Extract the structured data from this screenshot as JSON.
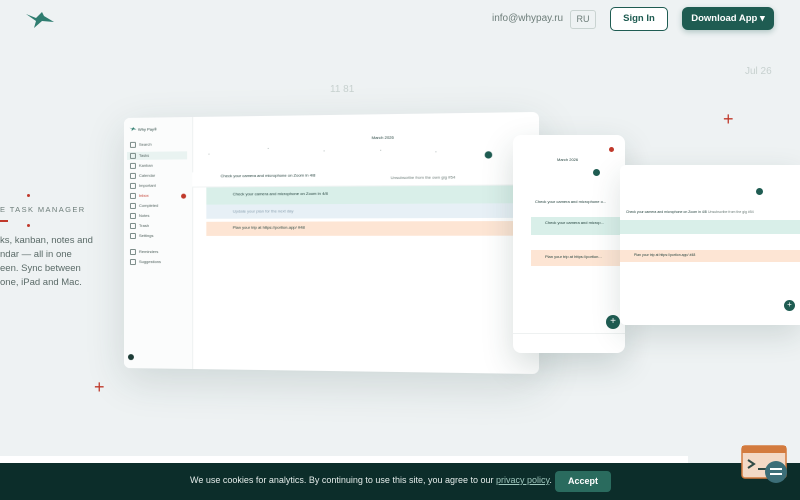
{
  "header": {
    "email": "info@whypay.ru",
    "lang": "RU",
    "sign_in": "Sign In",
    "download": "Download App ▾"
  },
  "decor": {
    "date_top_right": "Jul 26",
    "date_left": "11 81"
  },
  "hero": {
    "label": "E TASK MANAGER",
    "lines": [
      "ks, kanban, notes and",
      "ndar — all in one",
      "een. Sync between",
      "one, iPad and Mac."
    ]
  },
  "desktop_mock": {
    "app_name": "Why Pay®",
    "sidebar": [
      "Search",
      "Tasks",
      "Kanban",
      "Calendar",
      "Important",
      "Inbox",
      "Completed",
      "Notes",
      "Trash",
      "Settings",
      "Reminders",
      "Suggestions"
    ],
    "month": "March 2026",
    "tasks": [
      "Check your camera and microphone on Zoom in 4/8",
      "Check your camera and microphone on Zoom in 4/8",
      "Update your plan for the next day",
      "Plan your trip at https://portion.app/ #48"
    ],
    "task_side": "Unsubscribe from the own gig #54"
  },
  "tablet_mock": {
    "month": "March 2026",
    "task_a": "Check your camera and microphone o...",
    "task_b": "Check your camera and microp...",
    "task_c": "Plan your trip at https://portion..."
  },
  "right_mock": {
    "task_a": "Check your camera and microphone on Zoom in 4/8",
    "task_b": "Unsubscribe from the gig #54",
    "task_c": "Plan your trip at https://portion.app/ #48"
  },
  "cookie": {
    "text": "We use cookies for analytics. By continuing to use this site, you agree to our",
    "link": "privacy policy",
    "after": ".",
    "accept": "Accept"
  },
  "colors": {
    "brand": "#1f5c52",
    "accent_red": "#c0392b",
    "cookie_bg": "#0c2d2a"
  },
  "icons": {
    "logo": "bird-logo-icon",
    "chat": "chat-widget-icon"
  }
}
